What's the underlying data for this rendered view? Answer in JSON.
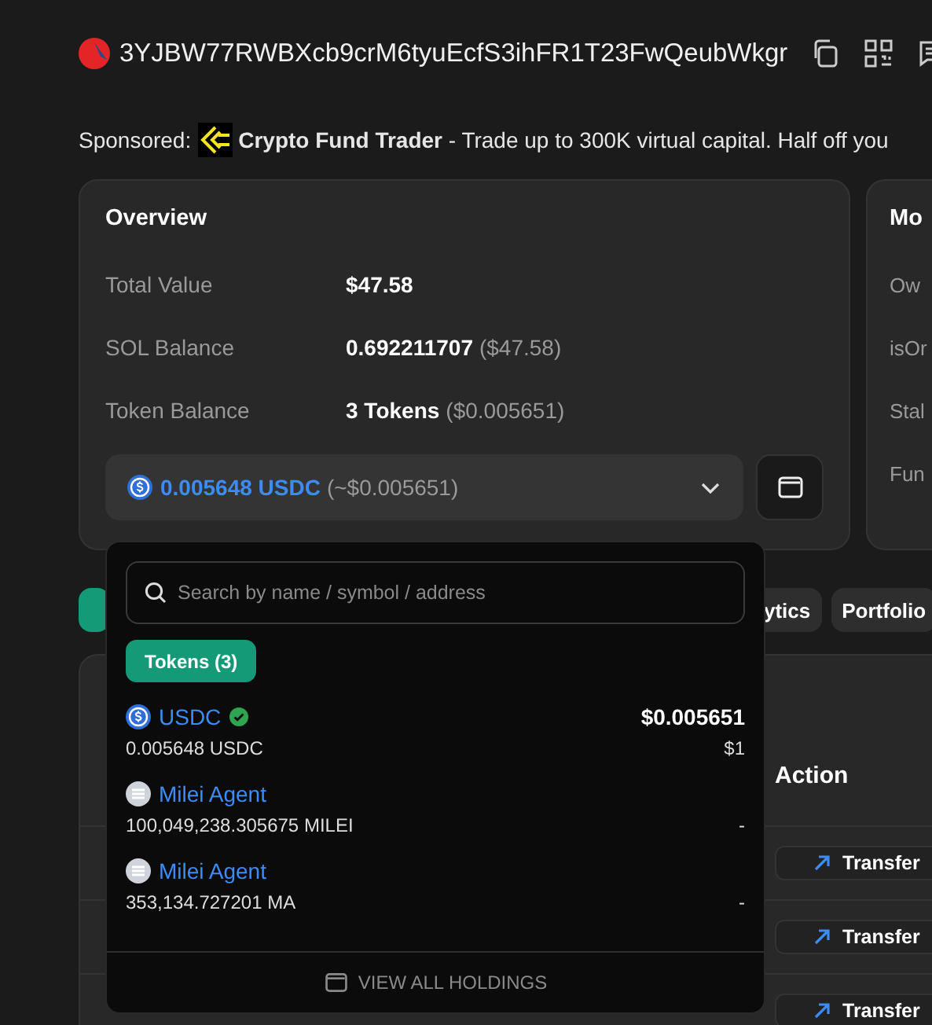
{
  "header": {
    "address": "3YJBW77RWBXcb9crM6tyuEcfS3ihFR1T23FwQeubWkgr"
  },
  "sponsor": {
    "label": "Sponsored:",
    "text": "**Crypto Fund Trader** - Trade up to 300K virtual capital. Half off you"
  },
  "overview": {
    "title": "Overview",
    "rows": [
      {
        "label": "Total Value",
        "value": "$47.58"
      },
      {
        "label": "SOL Balance",
        "value": "0.692211707",
        "note": "($47.58)"
      },
      {
        "label": "Token Balance",
        "value": "3 Tokens",
        "note": "($0.005651)"
      }
    ],
    "token_select": {
      "amount": "0.005648 USDC",
      "note": "(~$0.005651)",
      "expanded": true
    }
  },
  "side_card": {
    "title": "Mo",
    "labels": [
      "Ow",
      "isOr",
      "Stal",
      "Fun"
    ]
  },
  "tabs": [
    {
      "selected": true
    },
    {
      "label": "ytics",
      "selected": false
    },
    {
      "label": "Portfolio",
      "selected": false
    }
  ],
  "table": {
    "action_header": "Action",
    "rows": [
      {
        "action": "Transfer"
      },
      {
        "action": "Transfer"
      },
      {
        "action": "Transfer"
      }
    ]
  },
  "dropdown": {
    "search": {
      "placeholder": "Search by name / symbol / address"
    },
    "filter": "Tokens (3)",
    "tokens": [
      {
        "kind": "usdc",
        "name": "USDC",
        "verified": true,
        "balance": "0.005648 USDC",
        "value": "$0.005651",
        "price": "$1"
      },
      {
        "kind": "generic",
        "name": "Milei Agent",
        "verified": false,
        "balance": "100,049,238.305675 MILEI",
        "price": "-"
      },
      {
        "kind": "generic",
        "name": "Milei Agent",
        "verified": false,
        "balance": "353,134.727201 MA",
        "price": "-"
      }
    ],
    "footer": "VIEW ALL HOLDINGS"
  }
}
